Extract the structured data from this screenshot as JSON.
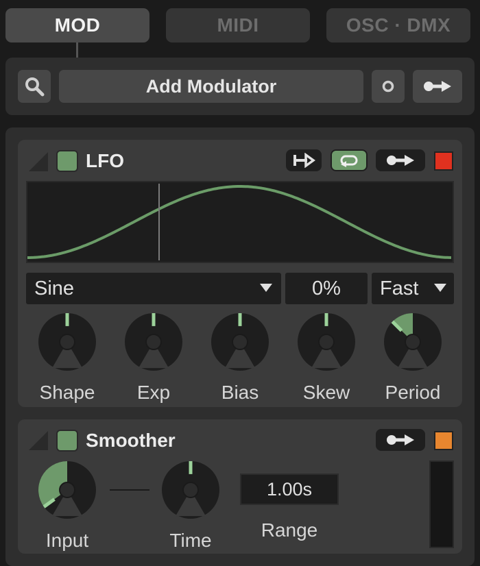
{
  "tabs": [
    {
      "label": "MOD",
      "active": true
    },
    {
      "label": "MIDI",
      "active": false
    },
    {
      "label": "OSC · DMX",
      "active": false
    }
  ],
  "toolbar": {
    "add_label": "Add Modulator"
  },
  "lfo": {
    "title": "LFO",
    "color": "#e0311f",
    "waveform": "Sine",
    "phase": "0%",
    "speed": "Fast",
    "knobs": [
      {
        "label": "Shape",
        "value": 0.5
      },
      {
        "label": "Exp",
        "value": 0.5
      },
      {
        "label": "Bias",
        "value": 0.5
      },
      {
        "label": "Skew",
        "value": 0.5
      },
      {
        "label": "Period",
        "value": 0.35
      }
    ]
  },
  "smoother": {
    "title": "Smoother",
    "color": "#e8862f",
    "range_value": "1.00s",
    "knobs": [
      {
        "label": "Input",
        "value": 0.08
      },
      {
        "label": "Time",
        "value": 0.5
      }
    ],
    "range_label": "Range"
  },
  "colors": {
    "accent": "#6e9a6b",
    "wave": "#6b9c68"
  }
}
